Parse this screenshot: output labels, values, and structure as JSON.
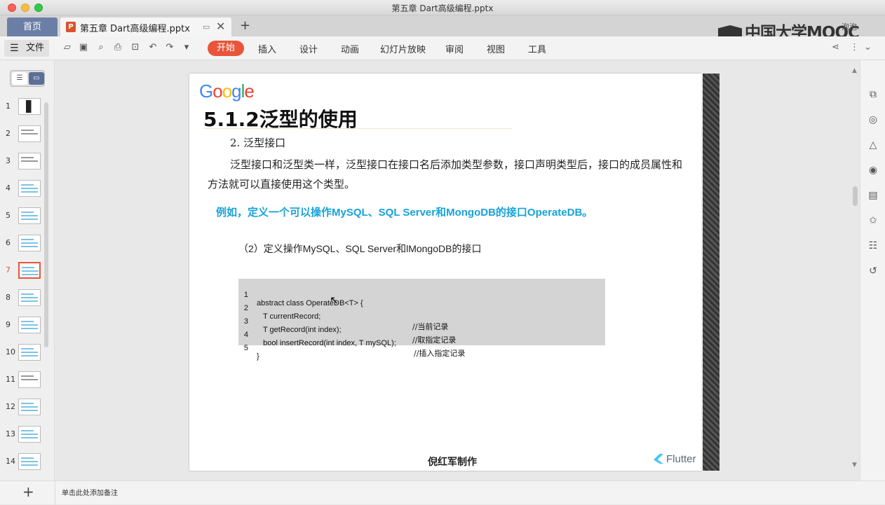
{
  "window": {
    "title": "第五章 Dart高级编程.pptx"
  },
  "tabs": {
    "home": "首页",
    "doc": "第五章 Dart高级编程.pptx",
    "doc_icon": "P",
    "add": "+",
    "close": "✕",
    "pin": "▭"
  },
  "brand": {
    "mooc": "中国大学MOOC",
    "user": "泡泡"
  },
  "toolbar": {
    "file": "文件",
    "menus": [
      "开始",
      "插入",
      "设计",
      "动画",
      "幻灯片放映",
      "审阅",
      "视图",
      "工具"
    ]
  },
  "slides_panel": {
    "numbers": [
      "1",
      "2",
      "3",
      "4",
      "5",
      "6",
      "7",
      "8",
      "9",
      "10",
      "11",
      "12",
      "13",
      "14"
    ],
    "active": "7"
  },
  "slide": {
    "logo_letters": [
      "G",
      "o",
      "o",
      "g",
      "l",
      "e"
    ],
    "title": "5.1.2泛型的使用",
    "sub_heading": "2. 泛型接口",
    "paragraph": "泛型接口和泛型类一样，泛型接口在接口名后添加类型参数，接口声明类型后，接口的成员属性和方法就可以直接使用这个类型。",
    "example": "例如，定义一个可以操作MySQL、SQL Server和MongoDB的接口OperateDB。",
    "step": "（2）定义操作MySQL、SQL Server和lMongoDB的接口",
    "code": [
      {
        "num": "1",
        "text": "abstract class OperateDB<T> {",
        "comment": ""
      },
      {
        "num": "2",
        "text": "   T currentRecord;",
        "comment": "//当前记录"
      },
      {
        "num": "3",
        "text": "   T getRecord(int index);",
        "comment": "//取指定记录"
      },
      {
        "num": "4",
        "text": "   bool insertRecord(int index, T mySQL);",
        "comment": "//插入指定记录"
      },
      {
        "num": "5",
        "text": "}",
        "comment": ""
      }
    ],
    "author": "倪红军制作",
    "flutter": "Flutter"
  },
  "status": {
    "notes": "单击此处添加备注",
    "add": "+"
  }
}
